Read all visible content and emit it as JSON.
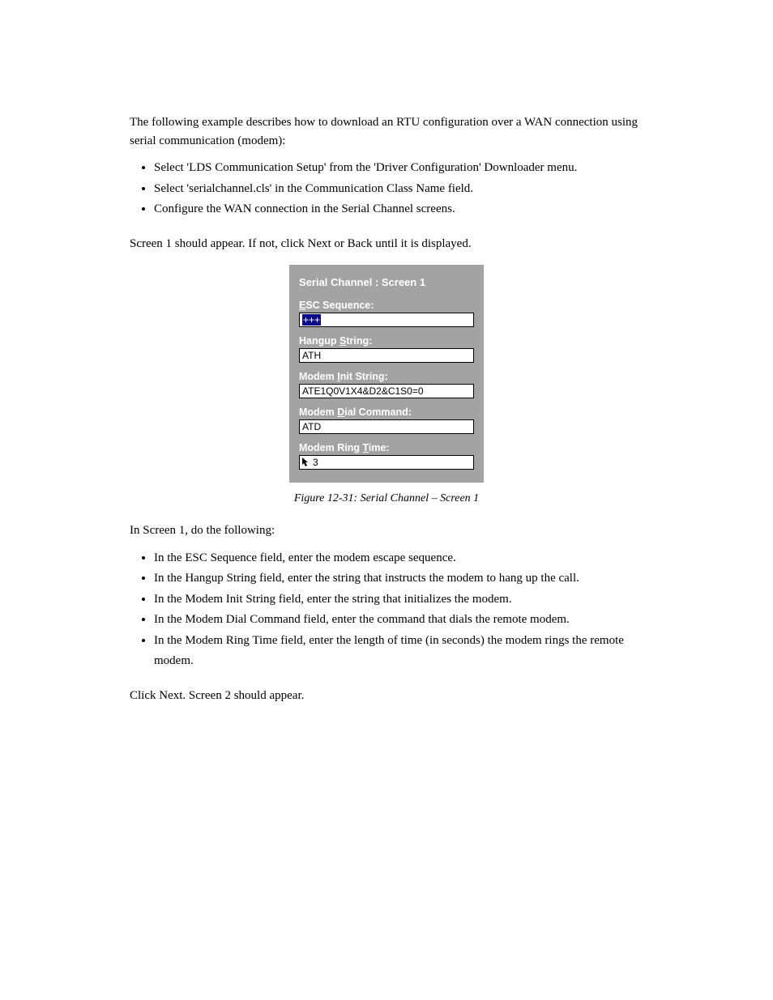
{
  "section1": {
    "intro": "The following example describes how to download an RTU configuration over a WAN connection using serial communication (modem):",
    "bullets": [
      "Select 'LDS Communication Setup' from the 'Driver Configuration' Downloader menu.",
      "Select 'serialchannel.cls' in the Communication Class Name field.",
      "Configure the WAN connection in the Serial Channel screens."
    ],
    "closing": "Screen 1 should appear. If not, click Next or Back until it is displayed."
  },
  "dialog": {
    "title": "Serial Channel : Screen 1",
    "fields": {
      "esc": {
        "label_pre": "",
        "label_ul": "E",
        "label_post": "SC Sequence:",
        "value": "+++"
      },
      "hangup": {
        "label_pre": "Hangup ",
        "label_ul": "S",
        "label_post": "tring:",
        "value": "ATH"
      },
      "init": {
        "label_pre": "Modem ",
        "label_ul": "I",
        "label_post": "nit String:",
        "value": "ATE1Q0V1X4&D2&C1S0=0"
      },
      "dial": {
        "label_pre": "Modem ",
        "label_ul": "D",
        "label_post": "ial Command:",
        "value": "ATD"
      },
      "ring": {
        "label_pre": "Modem Ring ",
        "label_ul": "T",
        "label_post": "ime:",
        "value": "3"
      }
    }
  },
  "caption": "Figure 12-31: Serial Channel – Screen 1",
  "section2": {
    "intro": "In Screen 1, do the following:",
    "bullets": [
      "In the ESC Sequence field, enter the modem escape sequence.",
      "In the Hangup String field, enter the string that instructs the modem to hang up the call.",
      "In the Modem Init String field, enter the string that initializes the modem.",
      "In the Modem Dial Command field, enter the command that dials the remote modem.",
      "In the Modem Ring Time field, enter the length of time (in seconds) the modem rings the remote modem."
    ],
    "closing": "Click Next. Screen 2 should appear."
  }
}
